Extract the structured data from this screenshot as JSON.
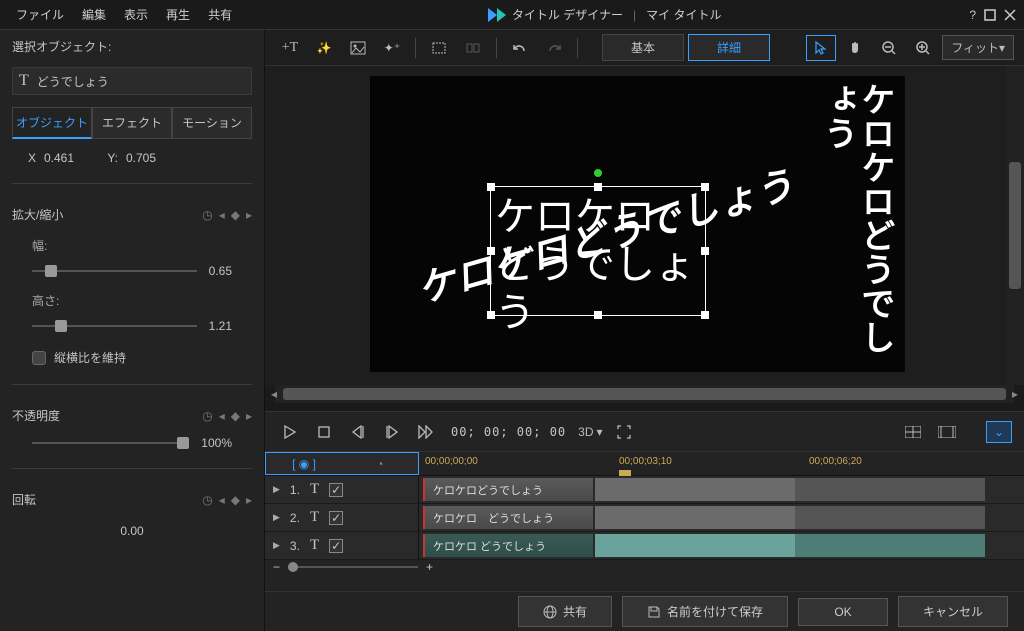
{
  "titleBar": {
    "menus": [
      "ファイル",
      "編集",
      "表示",
      "再生",
      "共有"
    ],
    "appName": "タイトル デザイナー",
    "docName": "マイ タイトル"
  },
  "leftPanel": {
    "sectionTitle": "選択オブジェクト:",
    "objectName": "どうでしょう",
    "tabs": {
      "object": "オブジェクト",
      "effect": "エフェクト",
      "motion": "モーション"
    },
    "coords": {
      "xLabel": "X",
      "xValue": "0.461",
      "yLabel": "Y:",
      "yValue": "0.705"
    },
    "scale": {
      "title": "拡大/縮小",
      "widthLabel": "幅:",
      "widthValue": "0.65",
      "heightLabel": "高さ:",
      "heightValue": "1.21",
      "keepAspect": "縦横比を維持"
    },
    "opacity": {
      "title": "不透明度",
      "value": "100%"
    },
    "rotation": {
      "title": "回転",
      "value": "0.00"
    }
  },
  "toolbar": {
    "modeBasic": "基本",
    "modeDetail": "詳細",
    "zoomLabel": "フィット"
  },
  "preview": {
    "text1": "ケロケロどうでしょう",
    "text2a": "ケロケロ",
    "text2b": "どうでしょう",
    "text3": "ケロケロ\nどうでしょう"
  },
  "playback": {
    "timecode": "00; 00; 00; 00",
    "threeDLabel": "3D"
  },
  "timeline": {
    "ticks": [
      "00;00;00;00",
      "00;00;03;10",
      "00;00;06;20"
    ],
    "tracks": [
      {
        "num": "1.",
        "label": "ケロケロどうでしょう"
      },
      {
        "num": "2.",
        "label": "ケロケロ　どうでしょう"
      },
      {
        "num": "3.",
        "label": "ケロケロ どうでしょう"
      }
    ]
  },
  "bottomBar": {
    "share": "共有",
    "saveAs": "名前を付けて保存",
    "ok": "OK",
    "cancel": "キャンセル"
  }
}
